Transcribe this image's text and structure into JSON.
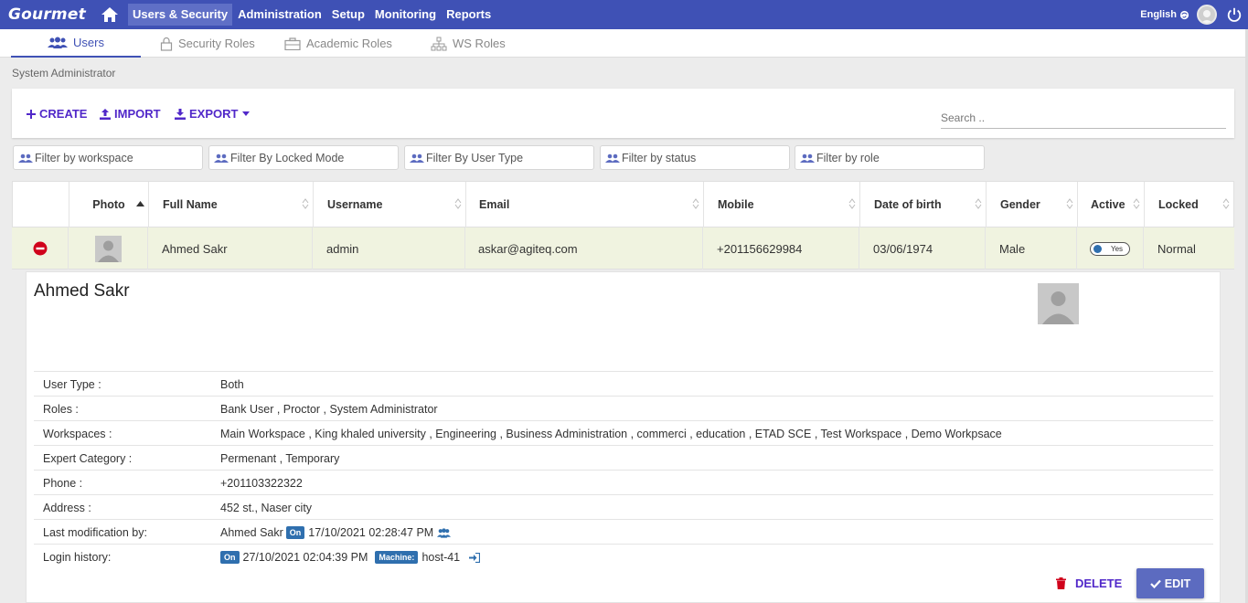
{
  "app": {
    "logo": "Gourmet"
  },
  "nav": {
    "items": [
      "Users & Security",
      "Administration",
      "Setup",
      "Monitoring",
      "Reports"
    ],
    "active": "Users & Security",
    "language": "English"
  },
  "subtabs": [
    "Users",
    "Security Roles",
    "Academic Roles",
    "WS Roles"
  ],
  "breadcrumb": "System Administrator",
  "toolbar": {
    "create": "CREATE",
    "import": "IMPORT",
    "export": "EXPORT",
    "search_placeholder": "Search .."
  },
  "filters": [
    "Filter by workspace",
    "Filter By Locked Mode",
    "Filter By User Type",
    "Filter by status",
    "Filter by role"
  ],
  "table": {
    "headers": [
      "Photo",
      "Full Name",
      "Username",
      "Email",
      "Mobile",
      "Date of birth",
      "Gender",
      "Active",
      "Locked"
    ],
    "row": {
      "full_name": "Ahmed Sakr",
      "username": "admin",
      "email": "askar@agiteq.com",
      "mobile": "+201156629984",
      "dob": "03/06/1974",
      "gender": "Male",
      "active": "Yes",
      "locked": "Normal"
    }
  },
  "detail": {
    "name": "Ahmed Sakr",
    "rows": [
      {
        "label": "User Type :",
        "value": "Both"
      },
      {
        "label": "Roles :",
        "value": "Bank User , Proctor , System Administrator"
      },
      {
        "label": "Workspaces :",
        "value": "Main Workspace , King khaled university , Engineering , Business Administration , commerci , education , ETAD SCE , Test Workspace , Demo Workpsace"
      },
      {
        "label": "Expert Category :",
        "value": "Permenant , Temporary"
      },
      {
        "label": "Phone :",
        "value": "+201103322322"
      },
      {
        "label": "Address :",
        "value": "452 st., Naser city"
      },
      {
        "label": "Last modification by:",
        "value": "Ahmed Sakr"
      },
      {
        "label": "Login history:",
        "value": ""
      }
    ],
    "lastmod": {
      "badge": "On",
      "time": "17/10/2021 02:28:47 PM"
    },
    "login": {
      "badge": "On",
      "time": "27/10/2021 02:04:39 PM",
      "machine_badge": "Machine:",
      "machine": "host-41"
    },
    "delete": "DELETE",
    "edit": "EDIT"
  },
  "colors": {
    "primary": "#3f51b5",
    "accent": "#5128c9",
    "row_highlight": "#f0f3e0",
    "danger": "#d0021b",
    "badge": "#2f6fae"
  }
}
